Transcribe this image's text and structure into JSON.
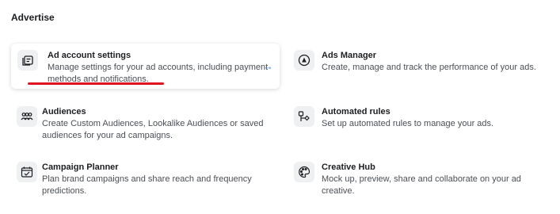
{
  "section": {
    "title": "Advertise"
  },
  "colors": {
    "accent": "#4a90e2",
    "annotation": "#e0141e"
  },
  "items": [
    {
      "title": "Ad account settings",
      "desc_line1": "Manage settings for your ad accounts, including payment",
      "desc_line2": "methods and notifications.",
      "icon": "ad-account-settings-icon",
      "highlighted": true,
      "arrow": "→"
    },
    {
      "title": "Ads Manager",
      "desc_line1": "Create, manage and track the performance of your ads.",
      "icon": "ads-manager-icon"
    },
    {
      "title": "Audiences",
      "desc_line1": "Create Custom Audiences, Lookalike Audiences or saved",
      "desc_line2": "audiences for your ad campaigns.",
      "icon": "audiences-icon"
    },
    {
      "title": "Automated rules",
      "desc_line1": "Set up automated rules to manage your ads.",
      "icon": "automated-rules-icon"
    },
    {
      "title": "Campaign Planner",
      "desc_line1": "Plan brand campaigns and share reach and frequency",
      "desc_line2": "predictions.",
      "icon": "campaign-planner-icon"
    },
    {
      "title": "Creative Hub",
      "desc_line1": "Mock up, preview, share and collaborate on your ad",
      "desc_line2": "creative.",
      "icon": "creative-hub-icon"
    }
  ]
}
